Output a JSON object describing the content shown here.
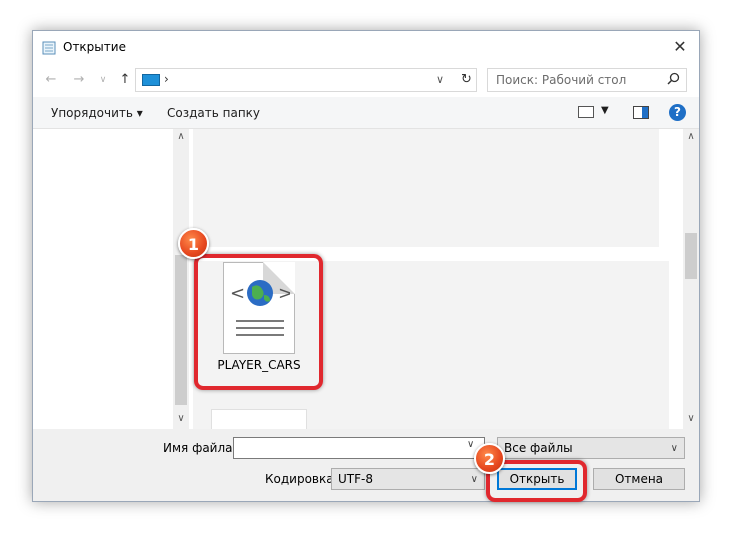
{
  "window": {
    "title": "Открытие",
    "close_icon": "close-icon"
  },
  "nav": {
    "back_icon": "arrow-left-icon",
    "forward_icon": "arrow-right-icon",
    "recent_icon": "chevron-down-icon",
    "up_icon": "arrow-up-icon",
    "address_chevron": "›",
    "refresh_icon": "refresh-icon",
    "search_placeholder": "Поиск: Рабочий стол",
    "search_icon": "search-icon"
  },
  "toolbar": {
    "organize_label": "Упорядочить ▾",
    "new_folder_label": "Создать папку",
    "help_label": "?"
  },
  "files": [
    {
      "name": "PLAYER_CARS",
      "icon": "html-file-icon"
    }
  ],
  "bottom": {
    "filename_label": "Имя файла:",
    "filename_value": "",
    "filter_value": "Все файлы",
    "encoding_label": "Кодировка:",
    "encoding_value": "UTF-8",
    "open_label": "Открыть",
    "cancel_label": "Отмена"
  },
  "annotations": {
    "badge1": "1",
    "badge2": "2",
    "highlight_color": "#e0282e",
    "badge_color": "#e6471f"
  }
}
